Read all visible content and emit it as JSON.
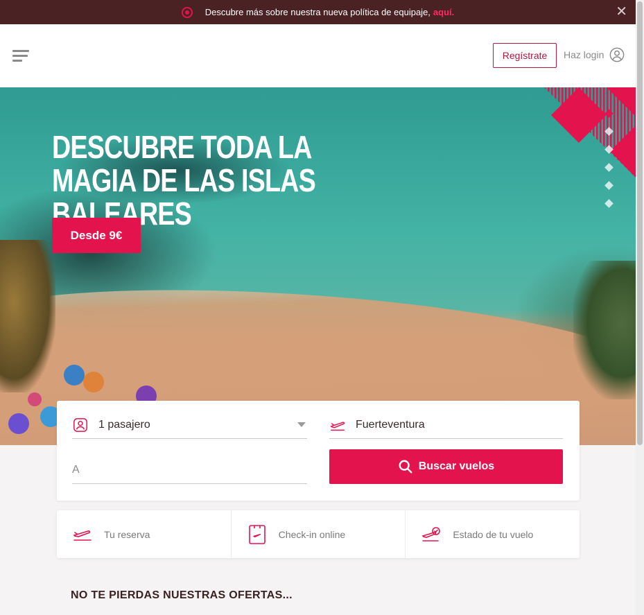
{
  "banner": {
    "text": "Descubre más sobre nuestra nueva política de equipaje,",
    "link": "aquí.",
    "close": "✕"
  },
  "header": {
    "register_label": "Regístrate",
    "login_label": "Haz login"
  },
  "hero": {
    "headline": "DESCUBRE TODA LA MAGIA DE LAS ISLAS BALEARES",
    "price_label": "Desde 9€",
    "slides": [
      true,
      false,
      false,
      false,
      false,
      false
    ]
  },
  "search": {
    "passengers": "1 pasajero",
    "origin": "Fuerteventura",
    "destination_placeholder": "A",
    "search_label": "Buscar vuelos"
  },
  "quick_links": [
    {
      "label": "Tu reserva",
      "icon": "plane-ticket-icon"
    },
    {
      "label": "Check-in online",
      "icon": "boarding-pass-icon"
    },
    {
      "label": "Estado de tu vuelo",
      "icon": "flight-status-icon"
    }
  ],
  "offers": {
    "title": "NO TE PIERDAS NUESTRAS OFERTAS..."
  },
  "colors": {
    "brand": "#e3134d",
    "banner_bg": "#4a2224"
  }
}
